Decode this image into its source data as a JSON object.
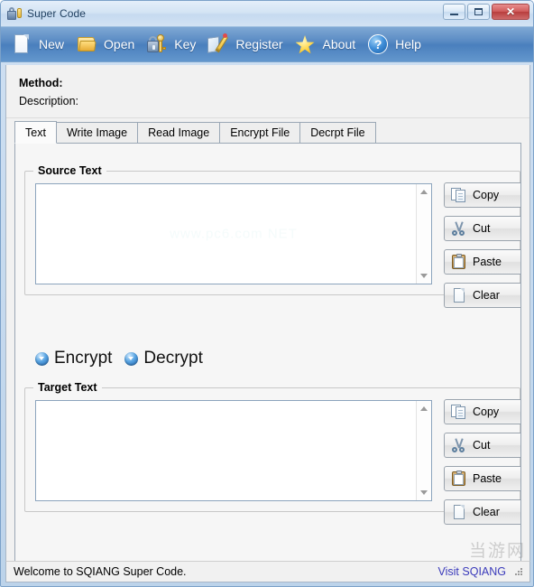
{
  "window": {
    "title": "Super Code",
    "icon": "lock-key-icon",
    "buttons": {
      "minimize": "minimize-button",
      "maximize": "maximize-button",
      "close_glyph": "✕"
    }
  },
  "toolbar": {
    "items": [
      {
        "label": "New",
        "icon": "new-document-icon"
      },
      {
        "label": "Open",
        "icon": "open-folder-icon"
      },
      {
        "label": "Key",
        "icon": "lock-key-icon"
      },
      {
        "label": "Register",
        "icon": "register-pen-icon"
      },
      {
        "label": "About",
        "icon": "star-icon"
      },
      {
        "label": "Help",
        "icon": "question-orb-icon"
      }
    ]
  },
  "meta": {
    "method_label": "Method:",
    "method_value": "",
    "description_label": "Description:",
    "description_value": ""
  },
  "tabs": [
    {
      "label": "Text",
      "selected": true
    },
    {
      "label": "Write Image",
      "selected": false
    },
    {
      "label": "Read Image",
      "selected": false
    },
    {
      "label": "Encrypt File",
      "selected": false
    },
    {
      "label": "Decrpt File",
      "selected": false
    }
  ],
  "source_group": {
    "title": "Source Text",
    "value": "",
    "watermark": "www.pc6.com NET"
  },
  "target_group": {
    "title": "Target Text",
    "value": ""
  },
  "source_buttons": [
    {
      "label": "Copy",
      "icon": "copy-icon"
    },
    {
      "label": "Cut",
      "icon": "scissors-icon"
    },
    {
      "label": "Paste",
      "icon": "clipboard-icon"
    },
    {
      "label": "Clear",
      "icon": "blank-page-icon"
    }
  ],
  "target_buttons": [
    {
      "label": "Copy",
      "icon": "copy-icon"
    },
    {
      "label": "Cut",
      "icon": "scissors-icon"
    },
    {
      "label": "Paste",
      "icon": "clipboard-icon"
    },
    {
      "label": "Clear",
      "icon": "blank-page-icon"
    }
  ],
  "modes": [
    {
      "label": "Encrypt",
      "icon": "blue-orb-icon"
    },
    {
      "label": "Decrypt",
      "icon": "blue-orb-icon"
    }
  ],
  "statusbar": {
    "message": "Welcome to SQIANG Super Code.",
    "link": "Visit SQIANG",
    "grip": "resize-grip-icon"
  },
  "watermark_corner": "当游网",
  "colors": {
    "toolbar_blue": "#4a7fbd",
    "titlebar_blue": "#d4e4f4",
    "close_red": "#b83d3d",
    "link_blue": "#3b3bbb",
    "client_gray": "#f1f1f1",
    "textbox_white": "#ffffff"
  }
}
